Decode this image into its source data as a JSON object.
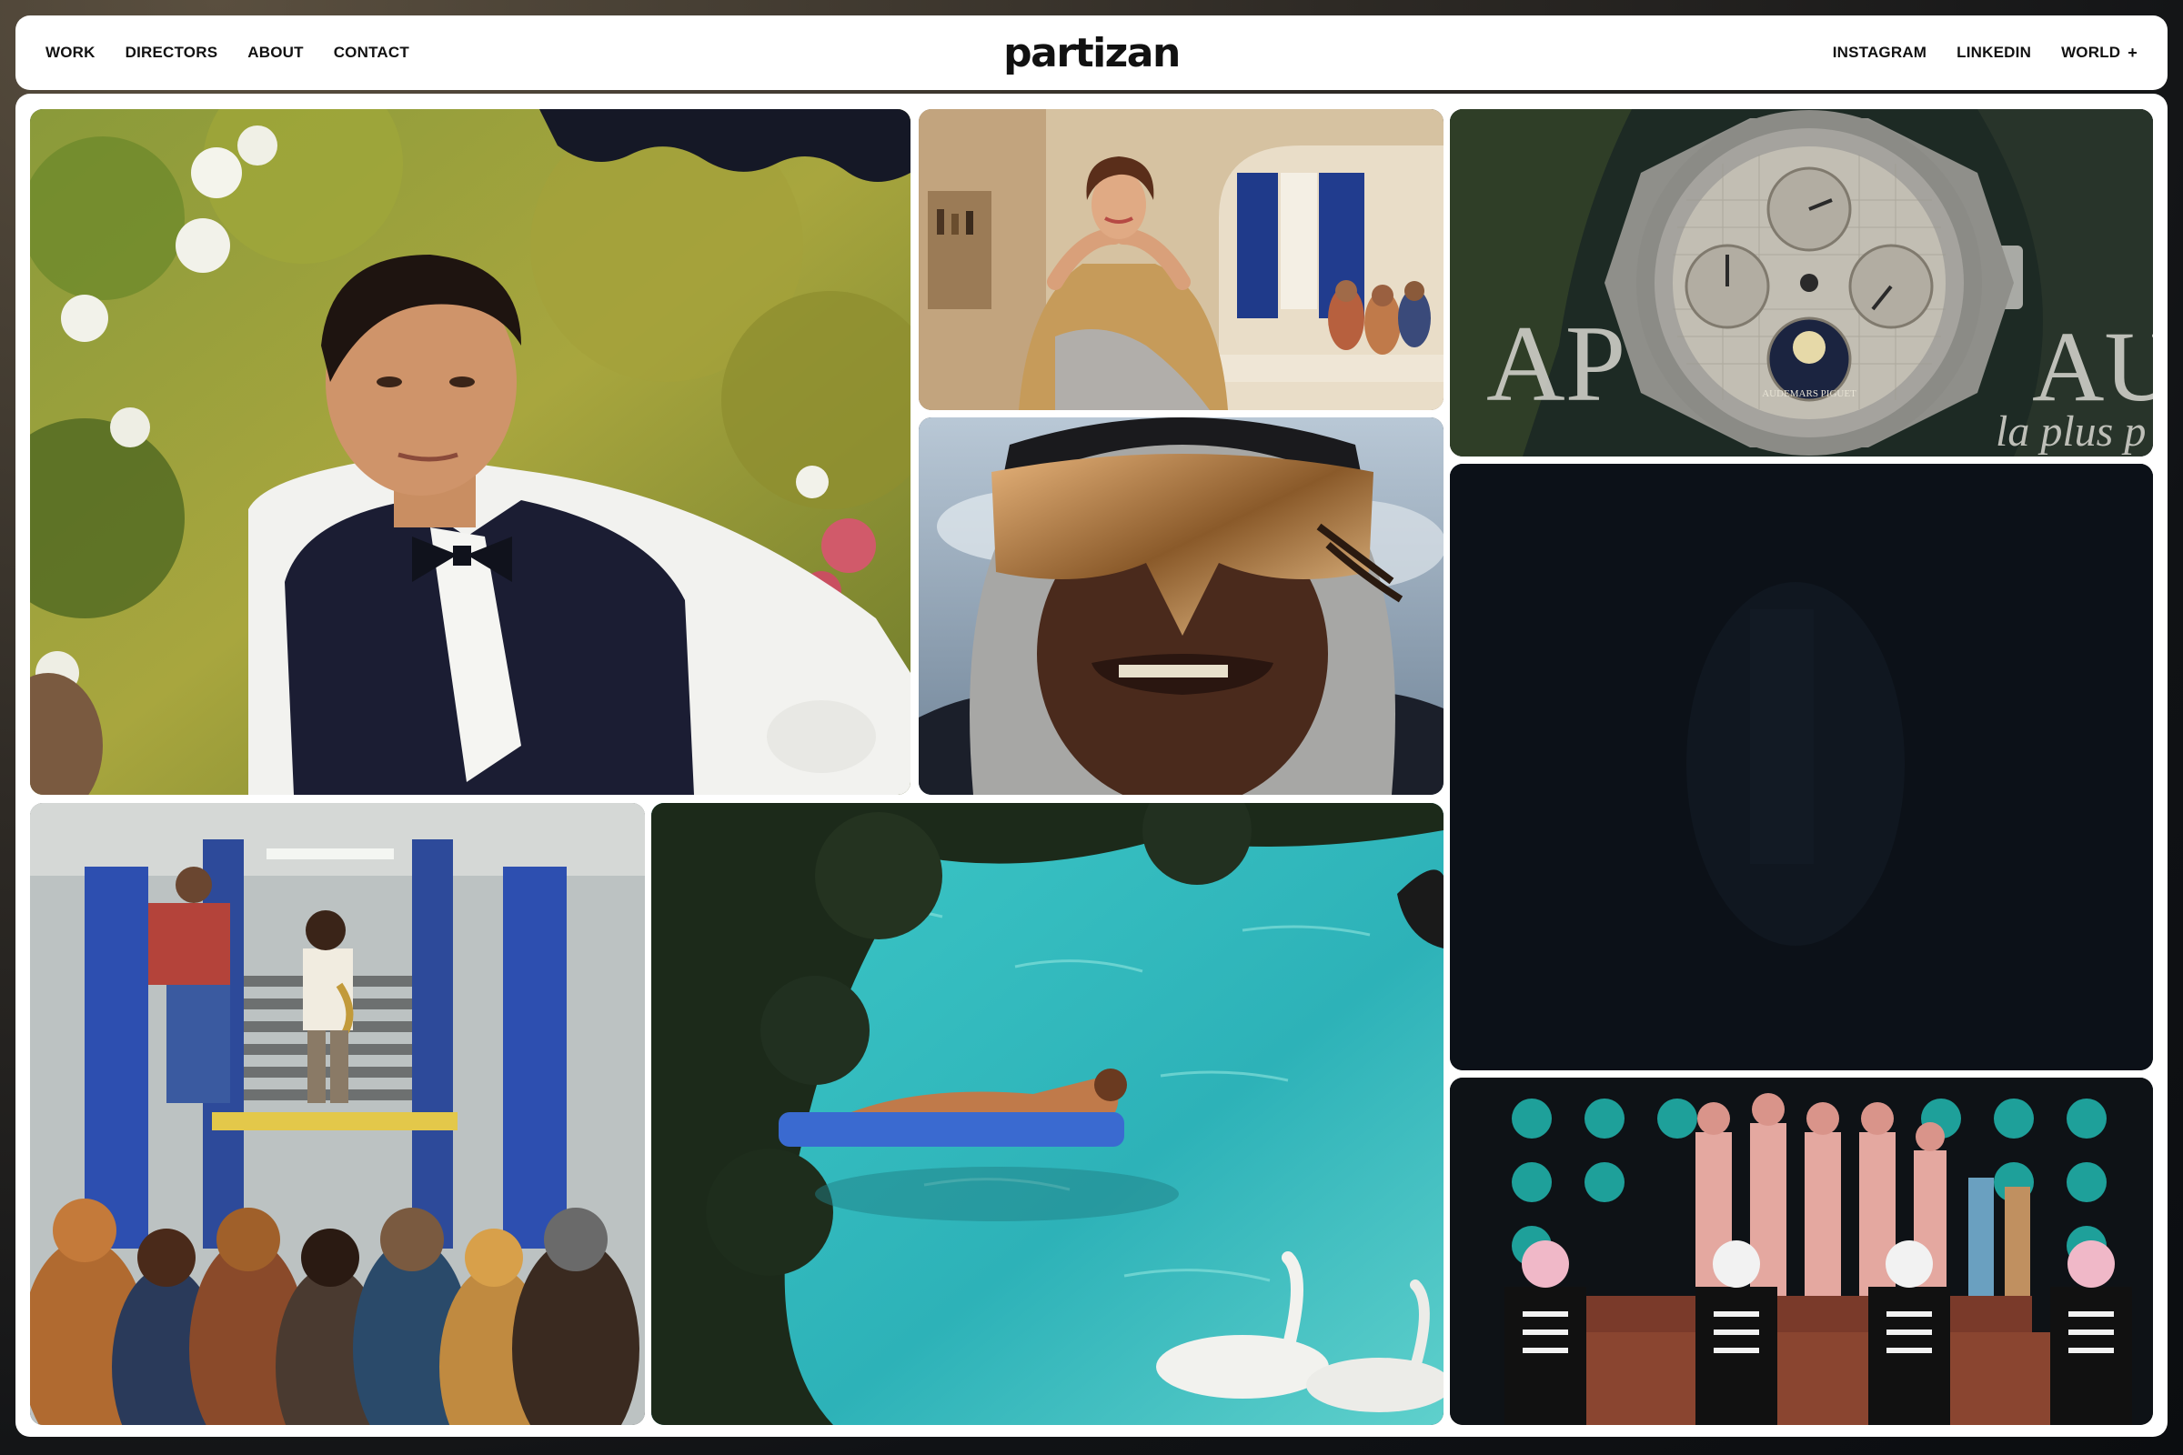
{
  "nav": {
    "left_links": [
      {
        "label": "WORK"
      },
      {
        "label": "DIRECTORS"
      },
      {
        "label": "ABOUT"
      },
      {
        "label": "CONTACT"
      }
    ],
    "logo": "partizan",
    "right_links": [
      {
        "label": "INSTAGRAM"
      },
      {
        "label": "LINKEDIN"
      },
      {
        "label": "WORLD"
      }
    ],
    "world_icon": "plus-icon",
    "world_icon_glyph": "+"
  },
  "grid": {
    "tiles": [
      {
        "name": "work-tile-waiter-garden"
      },
      {
        "name": "work-tile-woman-kitchen"
      },
      {
        "name": "work-tile-reflective-goggles"
      },
      {
        "name": "work-tile-luxury-watch"
      },
      {
        "name": "work-tile-dark-video"
      },
      {
        "name": "work-tile-subway-saxophone"
      },
      {
        "name": "work-tile-pool-swans"
      },
      {
        "name": "work-tile-skeleton-costumes"
      }
    ],
    "watch_text": {
      "brand_left": "AP",
      "brand_right": "AUDE",
      "tagline": "la plus p",
      "dial_text": "AUDEMARS PIGUET"
    }
  },
  "colors": {
    "nav_bg": "#ffffff",
    "text": "#111111",
    "pool": "#2fb9bd",
    "dark_tile": "#0c1118"
  }
}
